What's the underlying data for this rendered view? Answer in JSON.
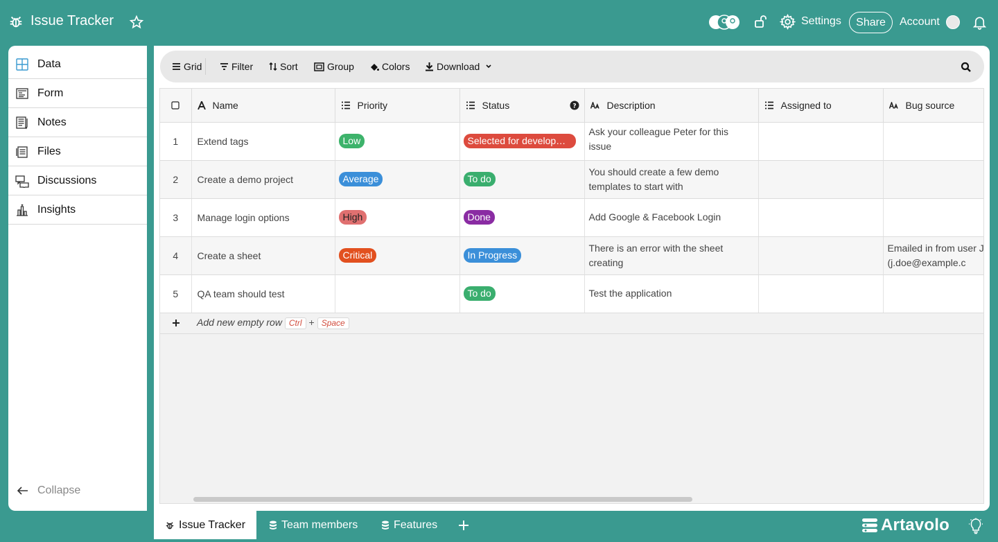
{
  "header": {
    "title": "Issue Tracker",
    "settings_label": "Settings",
    "share_label": "Share",
    "account_label": "Account"
  },
  "sidebar": {
    "items": [
      {
        "label": "Data",
        "icon": "grid-table-icon"
      },
      {
        "label": "Form",
        "icon": "form-icon"
      },
      {
        "label": "Notes",
        "icon": "notes-icon"
      },
      {
        "label": "Files",
        "icon": "files-icon"
      },
      {
        "label": "Discussions",
        "icon": "discussions-icon"
      },
      {
        "label": "Insights",
        "icon": "insights-icon"
      }
    ],
    "collapse_label": "Collapse"
  },
  "toolbar": {
    "grid": "Grid",
    "filter": "Filter",
    "sort": "Sort",
    "group": "Group",
    "colors": "Colors",
    "download": "Download"
  },
  "table": {
    "columns": [
      "Name",
      "Priority",
      "Status",
      "Description",
      "Assigned to",
      "Bug source"
    ],
    "rows": [
      {
        "num": "1",
        "name": "Extend tags",
        "priority": "Low",
        "status": "Selected for development",
        "description": "Ask your colleague Peter for this issue",
        "assigned": "",
        "bug_source": ""
      },
      {
        "num": "2",
        "name": "Create a demo project",
        "priority": "Average",
        "status": "To do",
        "description": "You should create a few demo templates to start with",
        "assigned": "",
        "bug_source": ""
      },
      {
        "num": "3",
        "name": "Manage login options",
        "priority": "High",
        "status": "Done",
        "description": "Add Google & Facebook Login",
        "assigned": "",
        "bug_source": ""
      },
      {
        "num": "4",
        "name": "Create a sheet",
        "priority": "Critical",
        "status": "In Progress",
        "description": "There is an error with the sheet creating",
        "assigned": "",
        "bug_source": "Emailed in from user J Doe (j.doe@example.c"
      },
      {
        "num": "5",
        "name": "QA team should test",
        "priority": "",
        "status": "To do",
        "description": "Test the application",
        "assigned": "",
        "bug_source": ""
      }
    ],
    "add_row": {
      "label": "Add new empty row",
      "key1": "Ctrl",
      "plus": "+",
      "key2": "Space"
    }
  },
  "colors": {
    "Low": "#3db36b",
    "Average": "#3b8fd9",
    "High": "#e07070",
    "Critical": "#e2501f",
    "Selected for development": "#dd4b3e",
    "To do": "#3aae6e",
    "Done": "#8a2ca3",
    "In Progress": "#3b8fd9",
    "accent": "#3a9a90"
  },
  "tabs": {
    "items": [
      "Issue Tracker",
      "Team members",
      "Features"
    ],
    "brand": "Artavolo"
  }
}
